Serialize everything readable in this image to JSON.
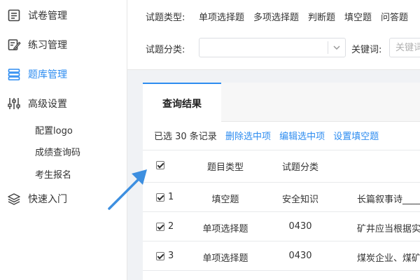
{
  "sidebar": {
    "items": [
      {
        "label": "试卷管理",
        "icon": "form-icon"
      },
      {
        "label": "练习管理",
        "icon": "edit-icon"
      },
      {
        "label": "题库管理",
        "icon": "database-icon",
        "active": true
      },
      {
        "label": "高级设置",
        "icon": "sliders-icon"
      },
      {
        "label": "快速入门",
        "icon": "layers-icon"
      }
    ],
    "sub_items": [
      "配置logo",
      "成绩查询码",
      "考生报名"
    ]
  },
  "filter": {
    "type_label": "试题类型:",
    "types": [
      "单项选择题",
      "多项选择题",
      "判断题",
      "填空题",
      "问答题"
    ],
    "category_label": "试题分类:",
    "category_value": "",
    "keyword_label": "关键词:",
    "keyword_placeholder": "关键词"
  },
  "results": {
    "tab": "查询结果",
    "selected_count": "已选 30 条记录",
    "actions": [
      "删除选中项",
      "编辑选中项",
      "设置填空题"
    ],
    "columns": [
      "题目类型",
      "试题分类"
    ],
    "rows": [
      {
        "index": "1",
        "type": "填空题",
        "category": "安全知识",
        "content": "长篇叙事诗____"
      },
      {
        "index": "2",
        "type": "单项选择题",
        "category": "0430",
        "content": "矿井应当根据实"
      },
      {
        "index": "3",
        "type": "单项选择题",
        "category": "0430",
        "content": "煤炭企业、煤矿"
      }
    ]
  },
  "colors": {
    "accent": "#2d8cf0",
    "arrow": "#3d8fe0"
  }
}
